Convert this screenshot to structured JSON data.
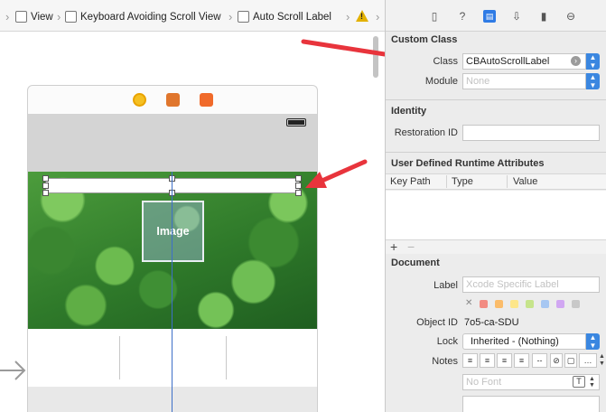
{
  "breadcrumb": {
    "items": [
      "View",
      "Keyboard Avoiding Scroll View",
      "Auto Scroll Label"
    ]
  },
  "canvas": {
    "image_label": "Image"
  },
  "inspector": {
    "tabs": [
      "file-icon",
      "help-icon",
      "identity-icon",
      "attributes-icon",
      "size-icon",
      "connections-icon"
    ],
    "custom_class": {
      "title": "Custom Class",
      "class_label": "Class",
      "class_value": "CBAutoScrollLabel",
      "module_label": "Module",
      "module_placeholder": "None"
    },
    "identity": {
      "title": "Identity",
      "restoration_label": "Restoration ID",
      "restoration_value": ""
    },
    "udra": {
      "title": "User Defined Runtime Attributes",
      "columns": [
        "Key Path",
        "Type",
        "Value"
      ],
      "add": "+",
      "remove": "−"
    },
    "document": {
      "title": "Document",
      "label_label": "Label",
      "label_placeholder": "Xcode Specific Label",
      "object_id_label": "Object ID",
      "object_id_value": "7o5-ca-SDU",
      "lock_label": "Lock",
      "lock_value": "Inherited - (Nothing)",
      "notes_label": "Notes",
      "font_placeholder": "No Font",
      "color_swatches": [
        "#f28b82",
        "#fbbc6a",
        "#fde68a",
        "#c6e48b",
        "#a7c7f2",
        "#d1a7f2",
        "#c8c8c8"
      ]
    }
  },
  "colors": {
    "accent": "#2f7be5",
    "annotation": "#e8343c",
    "guide": "#3d6fc8"
  }
}
